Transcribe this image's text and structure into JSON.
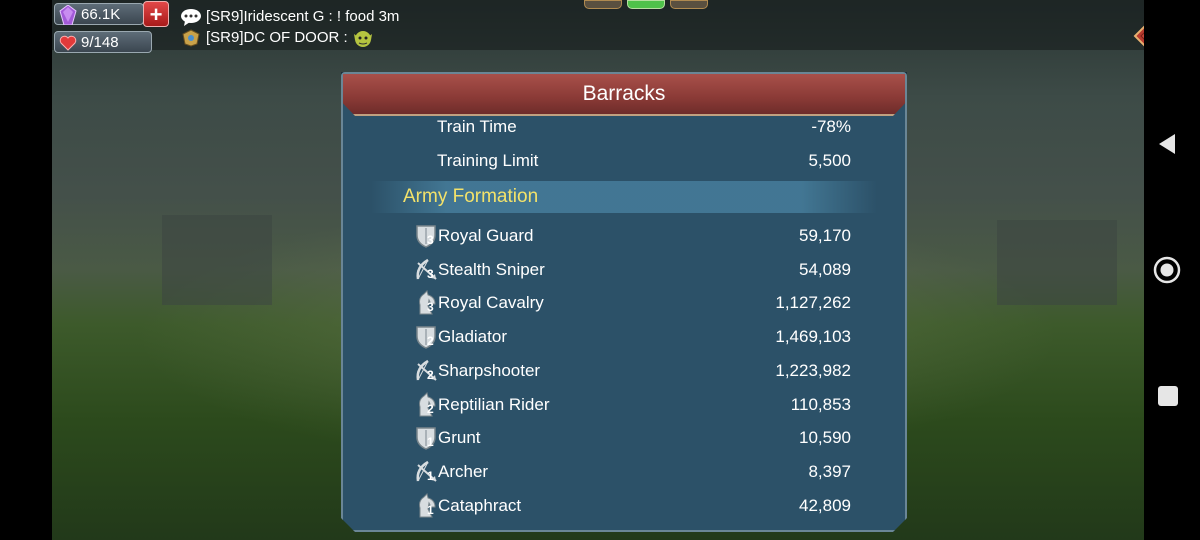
{
  "hud": {
    "gems": "66.1K",
    "stamina": "9/148",
    "plus_label": "+"
  },
  "chat": [
    {
      "text": "[SR9]Iridescent G : ! food 3m"
    },
    {
      "text": "[SR9]DC OF DOOR :"
    }
  ],
  "panel": {
    "title": "Barracks",
    "stats": [
      {
        "label": "Train Time",
        "value": "-78%"
      },
      {
        "label": "Training Limit",
        "value": "5,500"
      }
    ],
    "section_title": "Army Formation",
    "troops": [
      {
        "name": "Royal Guard",
        "tier": "3",
        "type": "infantry",
        "count": "59,170"
      },
      {
        "name": "Stealth Sniper",
        "tier": "3",
        "type": "ranged",
        "count": "54,089"
      },
      {
        "name": "Royal Cavalry",
        "tier": "3",
        "type": "cavalry",
        "count": "1,127,262"
      },
      {
        "name": "Gladiator",
        "tier": "2",
        "type": "infantry",
        "count": "1,469,103"
      },
      {
        "name": "Sharpshooter",
        "tier": "2",
        "type": "ranged",
        "count": "1,223,982"
      },
      {
        "name": "Reptilian Rider",
        "tier": "2",
        "type": "cavalry",
        "count": "110,853"
      },
      {
        "name": "Grunt",
        "tier": "1",
        "type": "infantry",
        "count": "10,590"
      },
      {
        "name": "Archer",
        "tier": "1",
        "type": "ranged",
        "count": "8,397"
      },
      {
        "name": "Cataphract",
        "tier": "1",
        "type": "cavalry",
        "count": "42,809"
      }
    ]
  },
  "colors": {
    "panel_bg": "#2c5168",
    "header_red": "#8a3a36",
    "section_yellow": "#f3e26a"
  }
}
